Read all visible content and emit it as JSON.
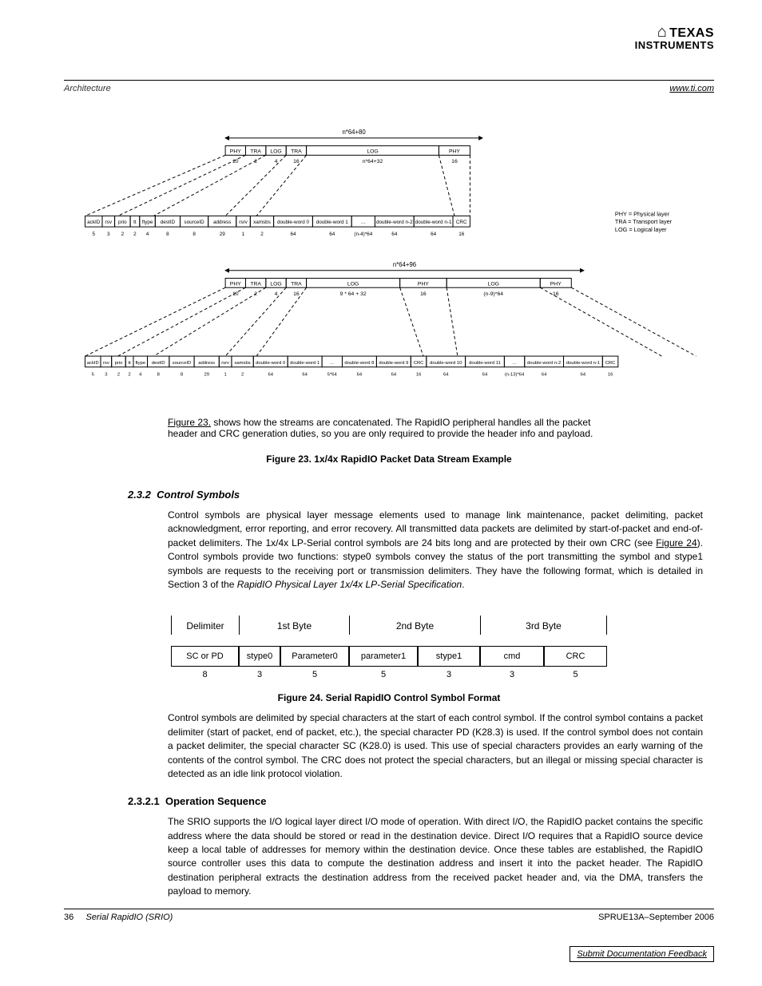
{
  "logo": {
    "top": "TEXAS",
    "bottom": "INSTRUMENTS",
    "chip": "⬢"
  },
  "header": {
    "url": "www.ti.com",
    "left": "Architecture",
    "right": ""
  },
  "figure23": {
    "caption_prefix": "Figure 23.",
    "caption_text": " 1x/4x RapidIO Packet Data Stream Example",
    "top_len_label": "n*64+80",
    "top_layers": [
      "PHY",
      "TRA",
      "LOG",
      "TRA",
      "LOG",
      "PHY"
    ],
    "top_layer_bits": [
      "10",
      "2",
      "4",
      "16",
      "n*64+32",
      "16"
    ],
    "low_len_label": "n*64+96",
    "low_layers": [
      "PHY",
      "TRA",
      "LOG",
      "TRA",
      "LOG",
      "PHY",
      "LOG",
      "PHY"
    ],
    "low_layer_bits": [
      "10",
      "2",
      "4",
      "16",
      "9 * 64 + 32",
      "16",
      "(n-9)*64",
      "16"
    ],
    "fields": [
      "ackID",
      "rsv",
      "prio",
      "tt",
      "ftype",
      "destID",
      "sourceID",
      "address",
      "rsrv",
      "xamsbs",
      "double-word 0",
      "double-word 1",
      "…",
      "double-word n-2",
      "double-word n-1",
      "CRC"
    ],
    "bits": [
      "5",
      "3",
      "2",
      "2",
      "4",
      "8",
      "8",
      "29",
      "1",
      "2",
      "64",
      "64",
      "(n-4)*64",
      "64",
      "64",
      "16"
    ],
    "low_fields": [
      "ackID",
      "rsv",
      "prio",
      "tt",
      "ftype",
      "destID",
      "sourceID",
      "address",
      "rsrv",
      "xamsbs",
      "double-word 0",
      "double-word 1",
      "…",
      "double-word 8",
      "double-word 9",
      "CRC",
      "double-word 10",
      "double-word 11",
      "…",
      "double-word n-2",
      "double-word n-1",
      "CRC"
    ],
    "low_bits": [
      "5",
      "3",
      "2",
      "2",
      "4",
      "8",
      "8",
      "29",
      "1",
      "2",
      "64",
      "64",
      "5*64",
      "64",
      "64",
      "16",
      "64",
      "64",
      "(n-13)*64",
      "64",
      "64",
      "16"
    ],
    "legend": [
      "PHY = Physical layer",
      "TRA = Transport layer",
      "LOG = Logical layer"
    ]
  },
  "para1_a": " shows how the streams are concatenated. The RapidIO peripheral handles all the packet",
  "para1_b": "header and CRC generation duties, so you are only required to provide the header info and payload.",
  "section": {
    "num": "2.3.2",
    "title": "Control Symbols"
  },
  "para2": "Control symbols are physical layer message elements used to manage link maintenance, packet delimiting, packet acknowledgment, error reporting, and error recovery. All transmitted data packets are delimited by start-of-packet and end-of-packet delimiters. The 1x/4x LP-Serial control symbols are 24 bits long and are protected by their own CRC (see ",
  "para2_link": "Figure 24",
  "para2_b": "). Control symbols provide two functions: stype0 symbols convey the status of the port transmitting the symbol and stype1 symbols are requests to the receiving port or transmission delimiters. They have the following format, which is detailed in Section 3 of the ",
  "para2_c": "RapidIO Physical Layer 1x/4x LP-Serial Specification",
  "para2_d": ".",
  "control_table": {
    "byte_headers": [
      "Delimiter",
      "1st Byte",
      "2nd Byte",
      "3rd Byte"
    ],
    "fields": [
      "SC or PD",
      "stype0",
      "Parameter0",
      "parameter1",
      "stype1",
      "cmd",
      "CRC"
    ],
    "bits": [
      "8",
      "3",
      "5",
      "5",
      "3",
      "3",
      "5"
    ]
  },
  "figure24": {
    "caption_prefix": "Figure 24.",
    "caption_text": " Serial RapidIO Control Symbol Format"
  },
  "para3": "Control symbols are delimited by special characters at the start of each control symbol. If the control symbol contains a packet delimiter (start of packet, end of packet, etc.), the special character PD (K28.3) is used. If the control symbol does not contain a packet delimiter, the special character SC (K28.0) is used. This use of special characters provides an early warning of the contents of the control symbol. The CRC does not protect the special characters, but an illegal or missing special character is detected as an idle link protocol violation.",
  "subsection": {
    "num": "2.3.2.1",
    "title": "Operation Sequence"
  },
  "para4": "The SRIO supports the I/O logical layer direct I/O mode of operation. With direct I/O, the RapidIO packet contains the specific address where the data should be stored or read in the destination device. Direct I/O requires that a RapidIO source device keep a local table of addresses for memory within the destination device. Once these tables are established, the RapidIO source controller uses this data to compute the destination address and insert it into the packet header. The RapidIO destination peripheral extracts the destination address from the received packet header and, via the DMA, transfers the payload to memory.",
  "footer": {
    "pagenum": "36",
    "center": "Serial RapidIO (SRIO)",
    "right": "SPRUE13A–September 2006",
    "feedback": "Submit Documentation Feedback"
  }
}
